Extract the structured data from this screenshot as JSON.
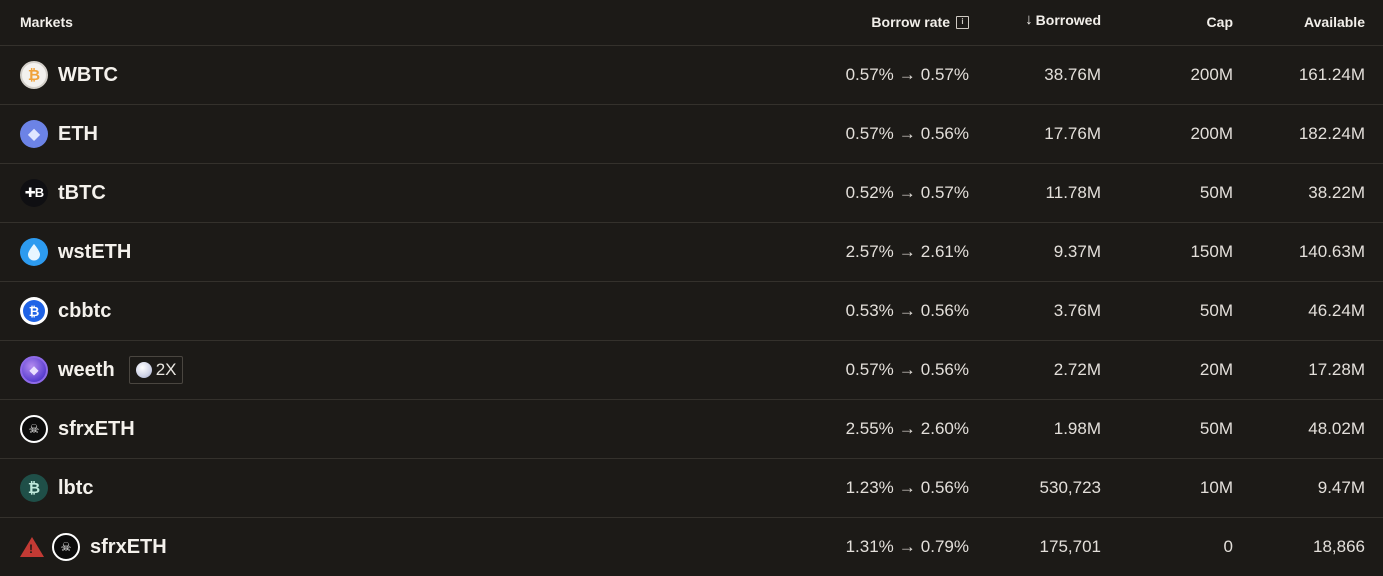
{
  "header": {
    "markets": "Markets",
    "borrow_rate": "Borrow rate",
    "info_icon": "info-icon",
    "sort_icon": "arrow-down-icon",
    "sort_glyph": "↓",
    "borrowed": "Borrowed",
    "cap": "Cap",
    "available": "Available"
  },
  "arrow_glyph": "→",
  "rows": [
    {
      "name": "WBTC",
      "icon": "wbtc-icon",
      "glyph": "₿",
      "rate_from": "0.57%",
      "rate_to": "0.57%",
      "borrowed": "38.76M",
      "cap": "200M",
      "available": "161.24M"
    },
    {
      "name": "ETH",
      "icon": "eth-icon",
      "glyph": "◆",
      "rate_from": "0.57%",
      "rate_to": "0.56%",
      "borrowed": "17.76M",
      "cap": "200M",
      "available": "182.24M"
    },
    {
      "name": "tBTC",
      "icon": "tbtc-icon",
      "glyph": "✚B",
      "rate_from": "0.52%",
      "rate_to": "0.57%",
      "borrowed": "11.78M",
      "cap": "50M",
      "available": "38.22M"
    },
    {
      "name": "wstETH",
      "icon": "wsteth-icon",
      "glyph": "💧",
      "rate_from": "2.57%",
      "rate_to": "2.61%",
      "borrowed": "9.37M",
      "cap": "150M",
      "available": "140.63M"
    },
    {
      "name": "cbbtc",
      "icon": "cbbtc-icon",
      "glyph": "₿",
      "rate_from": "0.53%",
      "rate_to": "0.56%",
      "borrowed": "3.76M",
      "cap": "50M",
      "available": "46.24M"
    },
    {
      "name": "weeth",
      "icon": "weeth-icon",
      "glyph": "◆",
      "badge": "2X",
      "rate_from": "0.57%",
      "rate_to": "0.56%",
      "borrowed": "2.72M",
      "cap": "20M",
      "available": "17.28M"
    },
    {
      "name": "sfrxETH",
      "icon": "sfrxeth-icon",
      "glyph": "☠",
      "rate_from": "2.55%",
      "rate_to": "2.60%",
      "borrowed": "1.98M",
      "cap": "50M",
      "available": "48.02M"
    },
    {
      "name": "lbtc",
      "icon": "lbtc-icon",
      "glyph": "₿",
      "rate_from": "1.23%",
      "rate_to": "0.56%",
      "borrowed": "530,723",
      "cap": "10M",
      "available": "9.47M"
    },
    {
      "name": "sfrxETH",
      "icon": "sfrxeth-icon",
      "glyph": "☠",
      "warning": "!",
      "rate_from": "1.31%",
      "rate_to": "0.79%",
      "borrowed": "175,701",
      "cap": "0",
      "available": "18,866"
    }
  ]
}
